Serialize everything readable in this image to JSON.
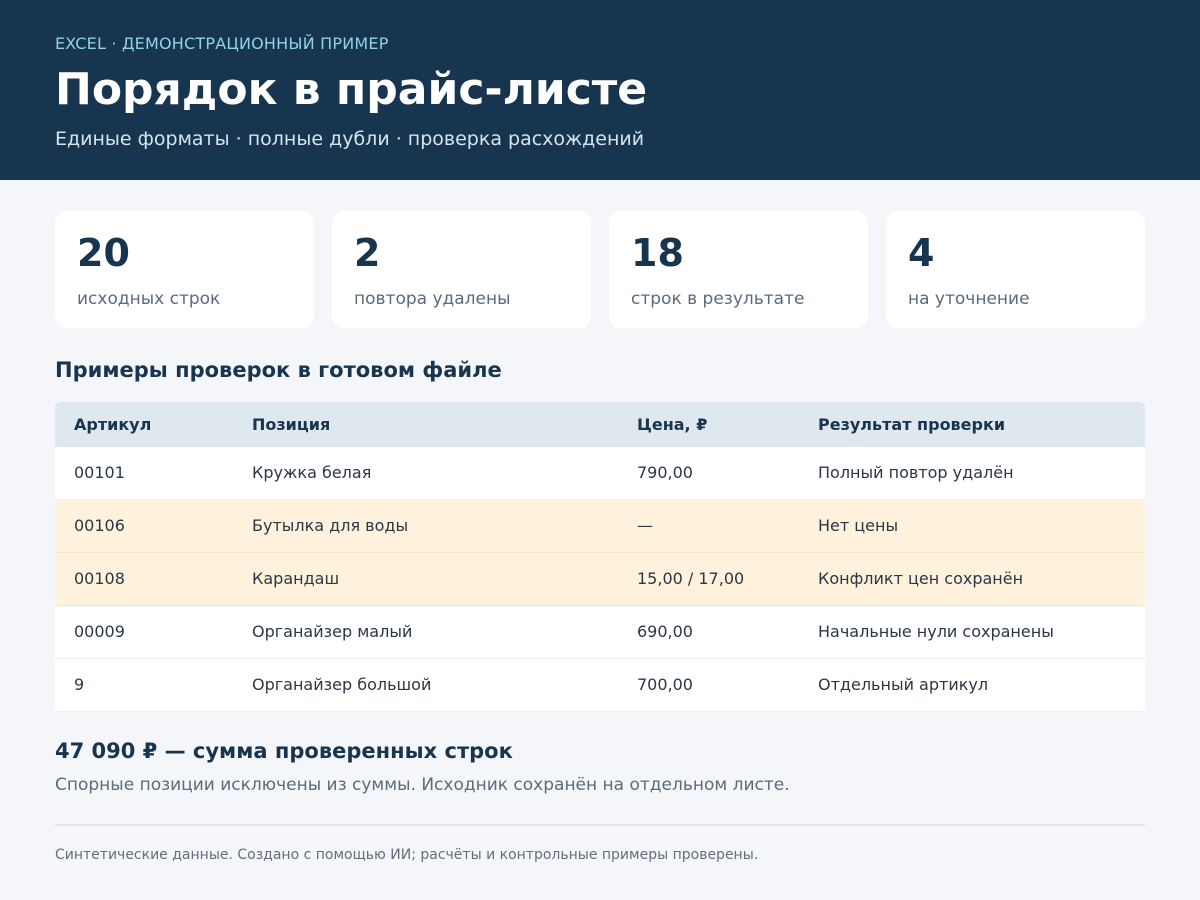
{
  "header": {
    "eyebrow": "EXCEL · ДЕМОНСТРАЦИОННЫЙ ПРИМЕР",
    "title": "Порядок в прайс-листе",
    "subtitle": "Единые форматы · полные дубли · проверка расхождений"
  },
  "kpis": [
    {
      "value": "20",
      "label": "исходных строк"
    },
    {
      "value": "2",
      "label": "повтора удалены"
    },
    {
      "value": "18",
      "label": "строк в результате"
    },
    {
      "value": "4",
      "label": "на уточнение"
    }
  ],
  "section": {
    "title": "Примеры проверок в готовом файле"
  },
  "table": {
    "headers": [
      "Артикул",
      "Позиция",
      "Цена, ₽",
      "Результат проверки"
    ],
    "rows": [
      {
        "sku": "00101",
        "item": "Кружка белая",
        "price": "790,00",
        "result": "Полный повтор удалён",
        "highlight": false
      },
      {
        "sku": "00106",
        "item": "Бутылка для воды",
        "price": "—",
        "result": "Нет цены",
        "highlight": true
      },
      {
        "sku": "00108",
        "item": "Карандаш",
        "price": "15,00 / 17,00",
        "result": "Конфликт цен сохранён",
        "highlight": true
      },
      {
        "sku": "00009",
        "item": "Органайзер малый",
        "price": "690,00",
        "result": "Начальные нули сохранены",
        "highlight": false
      },
      {
        "sku": "9",
        "item": "Органайзер большой",
        "price": "700,00",
        "result": "Отдельный артикул",
        "highlight": false
      }
    ]
  },
  "summary": {
    "total": "47 090 ₽ — сумма проверенных строк",
    "note": "Спорные позиции исключены из суммы. Исходник сохранён на отдельном листе."
  },
  "footer": {
    "text": "Синтетические данные. Создано с помощью ИИ; расчёты и контрольные примеры проверены."
  },
  "colors": {
    "header_bg": "#17354f",
    "accent": "#8fd3e8",
    "warn_row": "#fff2dc",
    "table_head": "#dfe7ef"
  }
}
